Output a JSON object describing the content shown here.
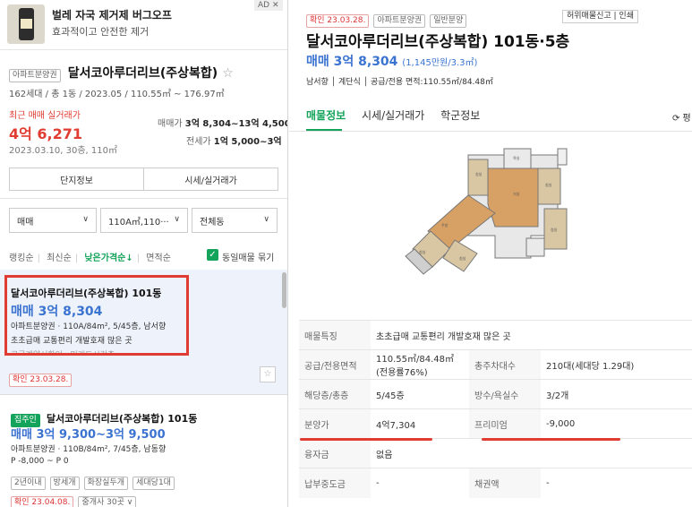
{
  "ad": {
    "badge": "AD ✕",
    "title": "벌레 자국 제거제 버그오프",
    "subtitle": "효과적이고 안전한 제거"
  },
  "summary": {
    "tag": "아파트분양권",
    "name": "달서코아루더리브(주상복합)",
    "star": "☆",
    "info": "162세대 / 총 1동 / 2023.05 / 110.55㎡ ~ 176.97㎡",
    "recent_label": "최근 매매 실거래가",
    "recent_price": "4억 6,271",
    "recent_date": "2023.03.10, 30층, 110㎡",
    "sale_label": "매매가",
    "sale_value": "3억 8,304~13억 4,500",
    "jeonse_label": "전세가",
    "jeonse_value": "1억 5,000~3억",
    "btn_complex": "단지정보",
    "btn_price": "시세/실거래가"
  },
  "filters": {
    "type": "매매",
    "area": "110A㎡,110···",
    "dong": "전체동"
  },
  "sort": {
    "opt1": "랭킹순",
    "opt2": "최신순",
    "opt3": "낮은가격순↓",
    "opt4": "면적순",
    "check_label": "동일매물 묶기"
  },
  "listing1": {
    "name": "달서코아루더리브(주상복합) 101동",
    "price": "매매 3억 8,304",
    "detail": "아파트분양권 · 110A/84m², 5/45층, 남서향",
    "desc": "초초급매 교통편리 개발호재 많은 곳",
    "extra": "공급계약서확인 · 미래도시건축",
    "confirm": "확인 23.03.28."
  },
  "listing2": {
    "tag": "집주인",
    "name": "달서코아루더리브(주상복합) 101동",
    "price": "매매 3억 9,300~3억 9,500",
    "detail": "아파트분양권 · 110B/84m², 7/45층, 남동향",
    "premium": "P -8,000 ~ P 0",
    "features": [
      "2년이내",
      "방세개",
      "화장실두개",
      "세대당1대"
    ],
    "confirm": "확인 23.04.08.",
    "agents": "중개사 30곳 ∨"
  },
  "detail": {
    "confirm_tag": "확인 23.03.28.",
    "tag2": "아파트분양권",
    "tag3": "일반분양",
    "report": "허위매물신고 | 인쇄",
    "title": "달서코아루더리브(주상복합) 101동·5층",
    "price": "매매 3억 8,304",
    "unit_price": "(1,145만원/3.3㎡)",
    "meta": "남서향 │ 계단식 │ 공급/전용 면적:110.55㎡/84.48㎡",
    "tabs": [
      "매물정보",
      "시세/실거래가",
      "학군정보"
    ],
    "refresh": "⟳ 평",
    "rows": [
      [
        "매물특징",
        "초초급매 교통편리 개발호재 많은 곳",
        "",
        ""
      ],
      [
        "공급/전용면적",
        "110.55㎡/84.48㎡(전용률76%)",
        "총주차대수",
        "210대(세대당 1.29대)"
      ],
      [
        "해당층/총층",
        "5/45층",
        "방수/욕실수",
        "3/2개"
      ],
      [
        "분양가",
        "4억7,304",
        "프리미엄",
        "-9,000"
      ],
      [
        "융자금",
        "없음",
        "",
        ""
      ],
      [
        "납부중도금",
        "-",
        "채권액",
        "-"
      ]
    ]
  },
  "colors": {
    "accent": "#13a35a",
    "price_blue": "#3b73d1",
    "highlight_red": "#e03c31"
  }
}
